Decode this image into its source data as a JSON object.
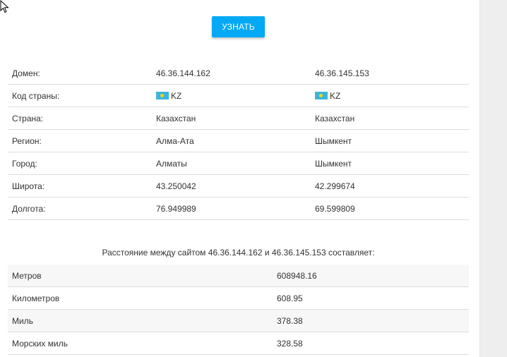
{
  "button": {
    "label": "УЗНАТЬ"
  },
  "info_table": {
    "rows": [
      {
        "label": "Домен:",
        "a": "46.36.144.162",
        "b": "46.36.145.153"
      },
      {
        "label": "Код страны:",
        "a": "KZ",
        "b": "KZ",
        "flag_icon": "kazakhstan-flag-icon"
      },
      {
        "label": "Страна:",
        "a": "Казахстан",
        "b": "Казахстан"
      },
      {
        "label": "Регион:",
        "a": "Алма-Ата",
        "b": "Шымкент"
      },
      {
        "label": "Город:",
        "a": "Алматы",
        "b": "Шымкент"
      },
      {
        "label": "Широта:",
        "a": "43.250042",
        "b": "42.299674"
      },
      {
        "label": "Долгота:",
        "a": "76.949989",
        "b": "69.599809"
      }
    ]
  },
  "distance": {
    "caption": "Расстояние между сайтом 46.36.144.162 и 46.36.145.153 составляет:",
    "rows": [
      {
        "label": "Метров",
        "value": "608948.16"
      },
      {
        "label": "Километров",
        "value": "608.95"
      },
      {
        "label": "Миль",
        "value": "378.38"
      },
      {
        "label": "Морских миль",
        "value": "328.58"
      }
    ]
  },
  "colors": {
    "accent": "#03a9f4",
    "flag_blue": "#3bb6d8",
    "flag_gold": "#f3d21a"
  },
  "icons": {
    "cursor": "mouse-pointer-icon"
  }
}
